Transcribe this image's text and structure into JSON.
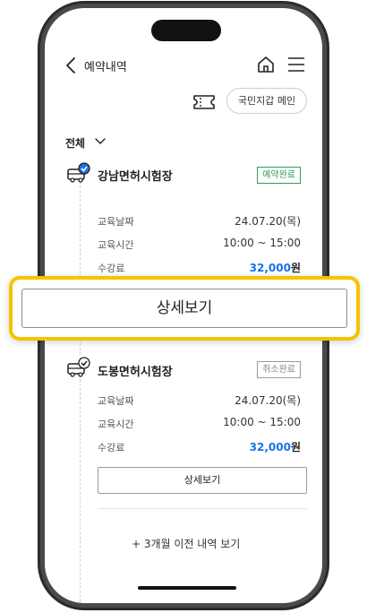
{
  "header": {
    "title": "예약내역"
  },
  "wallet": {
    "button_label": "국민지갑 메인"
  },
  "filter": {
    "label": "전체"
  },
  "reservations": [
    {
      "center": "강남면허시험장",
      "status": "예약완료",
      "status_color": "#2e9e5b",
      "rows": [
        {
          "label": "교육날짜",
          "value": "24.07.20(목)"
        },
        {
          "label": "교육시간",
          "value": "10:00 ~ 15:00"
        }
      ],
      "fee_label": "수강료",
      "fee_amount": "32,000",
      "fee_unit": "원",
      "detail_label": "상세보기"
    },
    {
      "center": "도봉면허시험장",
      "status": "취소완료",
      "status_color": "#888888",
      "rows": [
        {
          "label": "교육날짜",
          "value": "24.07.20(목)"
        },
        {
          "label": "교육시간",
          "value": "10:00 ~ 15:00"
        }
      ],
      "fee_label": "수강료",
      "fee_amount": "32,000",
      "fee_unit": "원",
      "detail_label": "상세보기"
    }
  ],
  "more": {
    "label": "3개월 이전 내역 보기"
  },
  "callout": {
    "label": "상세보기",
    "border_color": "#f5c400"
  },
  "icons": {
    "back": "chevron-left-icon",
    "home": "home-icon",
    "menu": "hamburger-menu-icon",
    "ticket": "ticket-icon",
    "bus": "bus-check-icon",
    "plus": "plus-icon"
  },
  "colors": {
    "accent_blue": "#1a73e8",
    "highlight_yellow": "#f5c400"
  }
}
